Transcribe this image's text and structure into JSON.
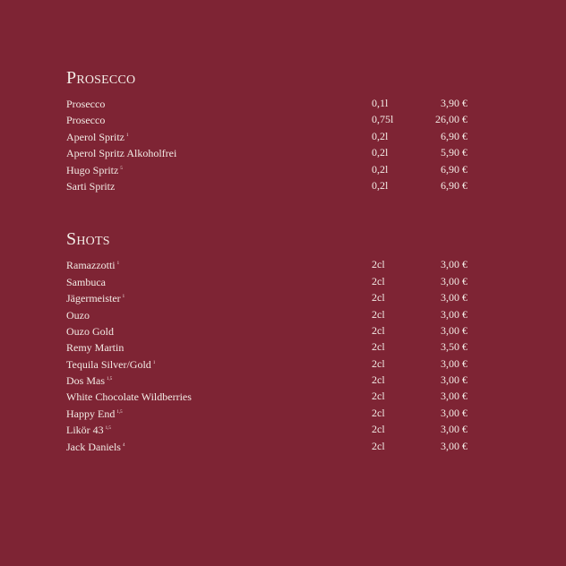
{
  "colors": {
    "background": "#7e2434",
    "text": "#f3ece6"
  },
  "sections": [
    {
      "title": "Prosecco",
      "items": [
        {
          "name": "Prosecco",
          "sup": "",
          "size": "0,1l",
          "price": "3,90 €"
        },
        {
          "name": "Prosecco",
          "sup": "",
          "size": "0,75l",
          "price": "26,00 €"
        },
        {
          "name": "Aperol Spritz",
          "sup": "1",
          "size": "0,2l",
          "price": "6,90 €"
        },
        {
          "name": "Aperol Spritz Alkoholfrei",
          "sup": "",
          "size": "0,2l",
          "price": "5,90 €"
        },
        {
          "name": "Hugo Spritz",
          "sup": "5",
          "size": "0,2l",
          "price": "6,90 €"
        },
        {
          "name": "Sarti Spritz",
          "sup": "",
          "size": "0,2l",
          "price": "6,90 €"
        }
      ]
    },
    {
      "title": "Shots",
      "items": [
        {
          "name": "Ramazzotti",
          "sup": "1",
          "size": "2cl",
          "price": "3,00 €"
        },
        {
          "name": "Sambuca",
          "sup": "",
          "size": "2cl",
          "price": "3,00 €"
        },
        {
          "name": "Jägermeister",
          "sup": "1",
          "size": "2cl",
          "price": "3,00 €"
        },
        {
          "name": "Ouzo",
          "sup": "",
          "size": "2cl",
          "price": "3,00 €"
        },
        {
          "name": "Ouzo Gold",
          "sup": "",
          "size": "2cl",
          "price": "3,00 €"
        },
        {
          "name": "Remy Martin",
          "sup": "",
          "size": "2cl",
          "price": "3,50 €"
        },
        {
          "name": "Tequila Silver/Gold",
          "sup": "1",
          "size": "2cl",
          "price": "3,00 €"
        },
        {
          "name": "Dos Mas",
          "sup": "1,5",
          "size": "2cl",
          "price": "3,00 €"
        },
        {
          "name": "White Chocolate Wildberries",
          "sup": "",
          "size": "2cl",
          "price": "3,00 €"
        },
        {
          "name": "Happy End",
          "sup": "1,5",
          "size": "2cl",
          "price": "3,00 €"
        },
        {
          "name": "Likör 43",
          "sup": "1,5",
          "size": "2cl",
          "price": "3,00 €"
        },
        {
          "name": "Jack Daniels",
          "sup": "4",
          "size": "2cl",
          "price": "3,00 €"
        }
      ]
    }
  ]
}
